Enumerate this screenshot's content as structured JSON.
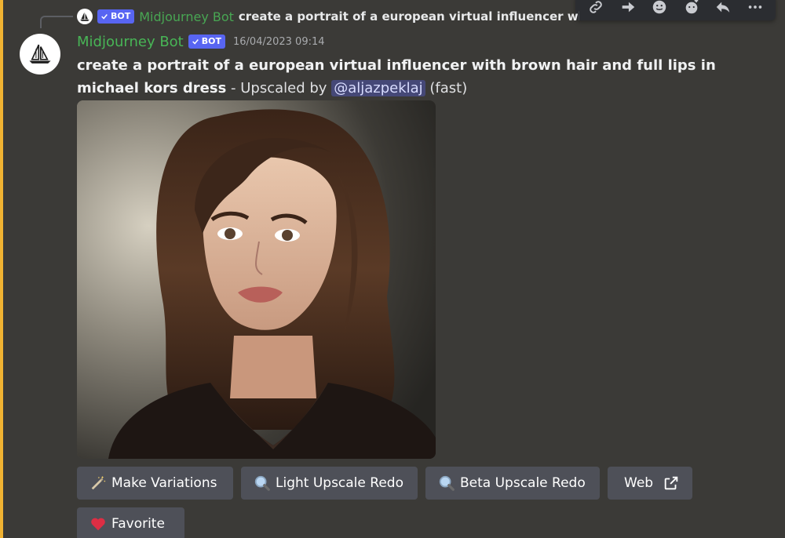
{
  "reply": {
    "username": "Midjourney Bot",
    "bot_tag": "BOT",
    "text": "create a portrait of a european virtual influencer with brown hair and full li"
  },
  "message": {
    "username": "Midjourney Bot",
    "bot_tag": "BOT",
    "timestamp": "16/04/2023 09:14",
    "prompt": "create a portrait of a european virtual influencer with brown hair and full lips in michael kors dress",
    "meta_prefix": " - Upscaled by ",
    "mention": "@aljazpeklaj",
    "meta_suffix": " (fast)"
  },
  "buttons": {
    "make_variations": "Make Variations",
    "light_upscale_redo": "Light Upscale Redo",
    "beta_upscale_redo": "Beta Upscale Redo",
    "web": "Web",
    "favorite": "Favorite"
  },
  "toolbar_icons": [
    "link-icon",
    "forward-icon",
    "add-reaction-icon",
    "react-icon",
    "reply-icon",
    "more-options-icon"
  ],
  "colors": {
    "background": "#3b3a37",
    "highlight": "#f0b232",
    "username": "#48b556",
    "bot_tag": "#5865f2",
    "button": "#4e5058"
  }
}
